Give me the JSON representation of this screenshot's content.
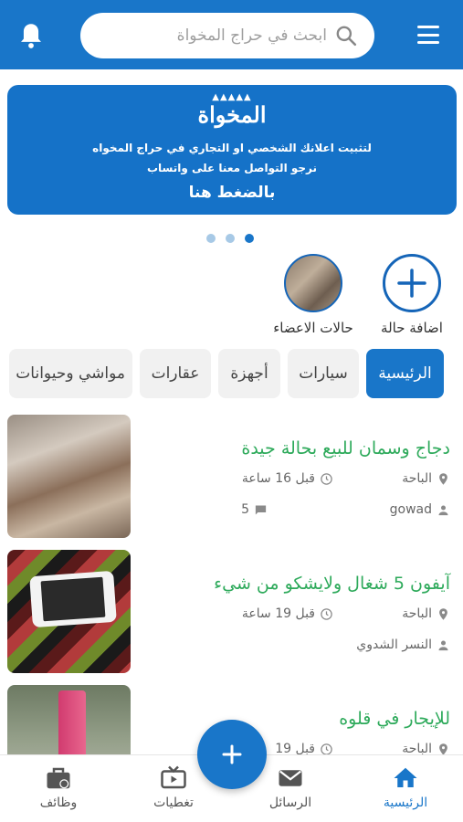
{
  "header": {
    "search_placeholder": "ابحث في حراج المخواة"
  },
  "banner": {
    "logo_text": "المخواة",
    "line1": "لتثبيت اعلانك الشخصي او التجاري في حراج المخواه",
    "line2": "نرجو التواصل معنا على واتساب",
    "cta": "بالضغط هنا"
  },
  "carousel": {
    "count": 3,
    "active_index": 2
  },
  "statuses": {
    "add_label": "اضافة حالة",
    "members_label": "حالات الاعضاء"
  },
  "tabs": [
    {
      "label": "الرئيسية",
      "active": true
    },
    {
      "label": "سيارات",
      "active": false
    },
    {
      "label": "أجهزة",
      "active": false
    },
    {
      "label": "عقارات",
      "active": false
    },
    {
      "label": "مواشي وحيوانات",
      "active": false
    }
  ],
  "listings": [
    {
      "title": "دجاج وسمان للبيع بحالة جيدة",
      "location": "الباحة",
      "time": "قبل 16 ساعة",
      "user": "gowad",
      "comments": "5"
    },
    {
      "title": "آيفون 5 شغال ولايشكو من شيء",
      "location": "الباحة",
      "time": "قبل 19 ساعة",
      "user": "النسر الشدوي"
    },
    {
      "title": "للإيجار في قلوه",
      "location": "الباحة",
      "time": "قبل 19"
    }
  ],
  "bottom_nav": {
    "home": "الرئيسية",
    "messages": "الرسائل",
    "coverage": "تغطيات",
    "jobs": "وظائف"
  },
  "colors": {
    "primary": "#1976c9",
    "title_green": "#2eaa5b"
  }
}
